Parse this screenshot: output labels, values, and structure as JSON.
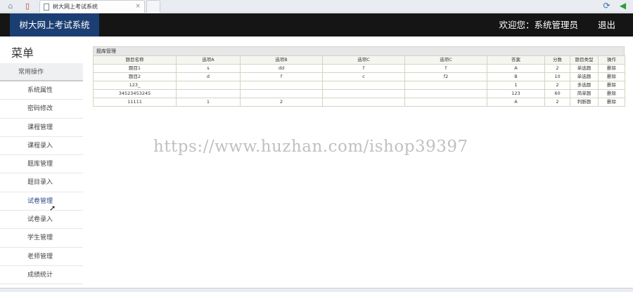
{
  "browser": {
    "tab_title": "树大网上考试系统",
    "tab_close": "×"
  },
  "header": {
    "brand": "树大网上考试系统",
    "welcome": "欢迎您：系统管理员",
    "logout": "退出"
  },
  "sidebar": {
    "title": "菜单",
    "group": "常用操作",
    "items": [
      {
        "label": "系统属性"
      },
      {
        "label": "密码修改"
      },
      {
        "label": "课程管理"
      },
      {
        "label": "课程录入"
      },
      {
        "label": "题库管理"
      },
      {
        "label": "题目录入"
      },
      {
        "label": "试卷管理"
      },
      {
        "label": "试卷录入"
      },
      {
        "label": "学生管理"
      },
      {
        "label": "老师管理"
      },
      {
        "label": "成绩统计"
      }
    ]
  },
  "main": {
    "panel_title": "题库管理",
    "columns": [
      "题目名称",
      "选项A",
      "选项B",
      "选项C",
      "选项C",
      "答案",
      "分数",
      "题目类型",
      "操作"
    ],
    "rows": [
      [
        "题目1",
        "s",
        "dd",
        "f",
        "f",
        "A",
        "2",
        "单选题",
        "删除"
      ],
      [
        "题目2",
        "d",
        "f",
        "c",
        "f2",
        "B",
        "10",
        "单选题",
        "删除"
      ],
      [
        "123_",
        "",
        "",
        "",
        "",
        "1",
        "2",
        "多选题",
        "删除"
      ],
      [
        "34523453245",
        "",
        "",
        "",
        "",
        "123",
        "60",
        "简单题",
        "删除"
      ],
      [
        "11111",
        "1",
        "2",
        "",
        "",
        "A",
        "2",
        "判断题",
        "删除"
      ]
    ]
  },
  "watermark": "https://www.huzhan.com/ishop39397"
}
